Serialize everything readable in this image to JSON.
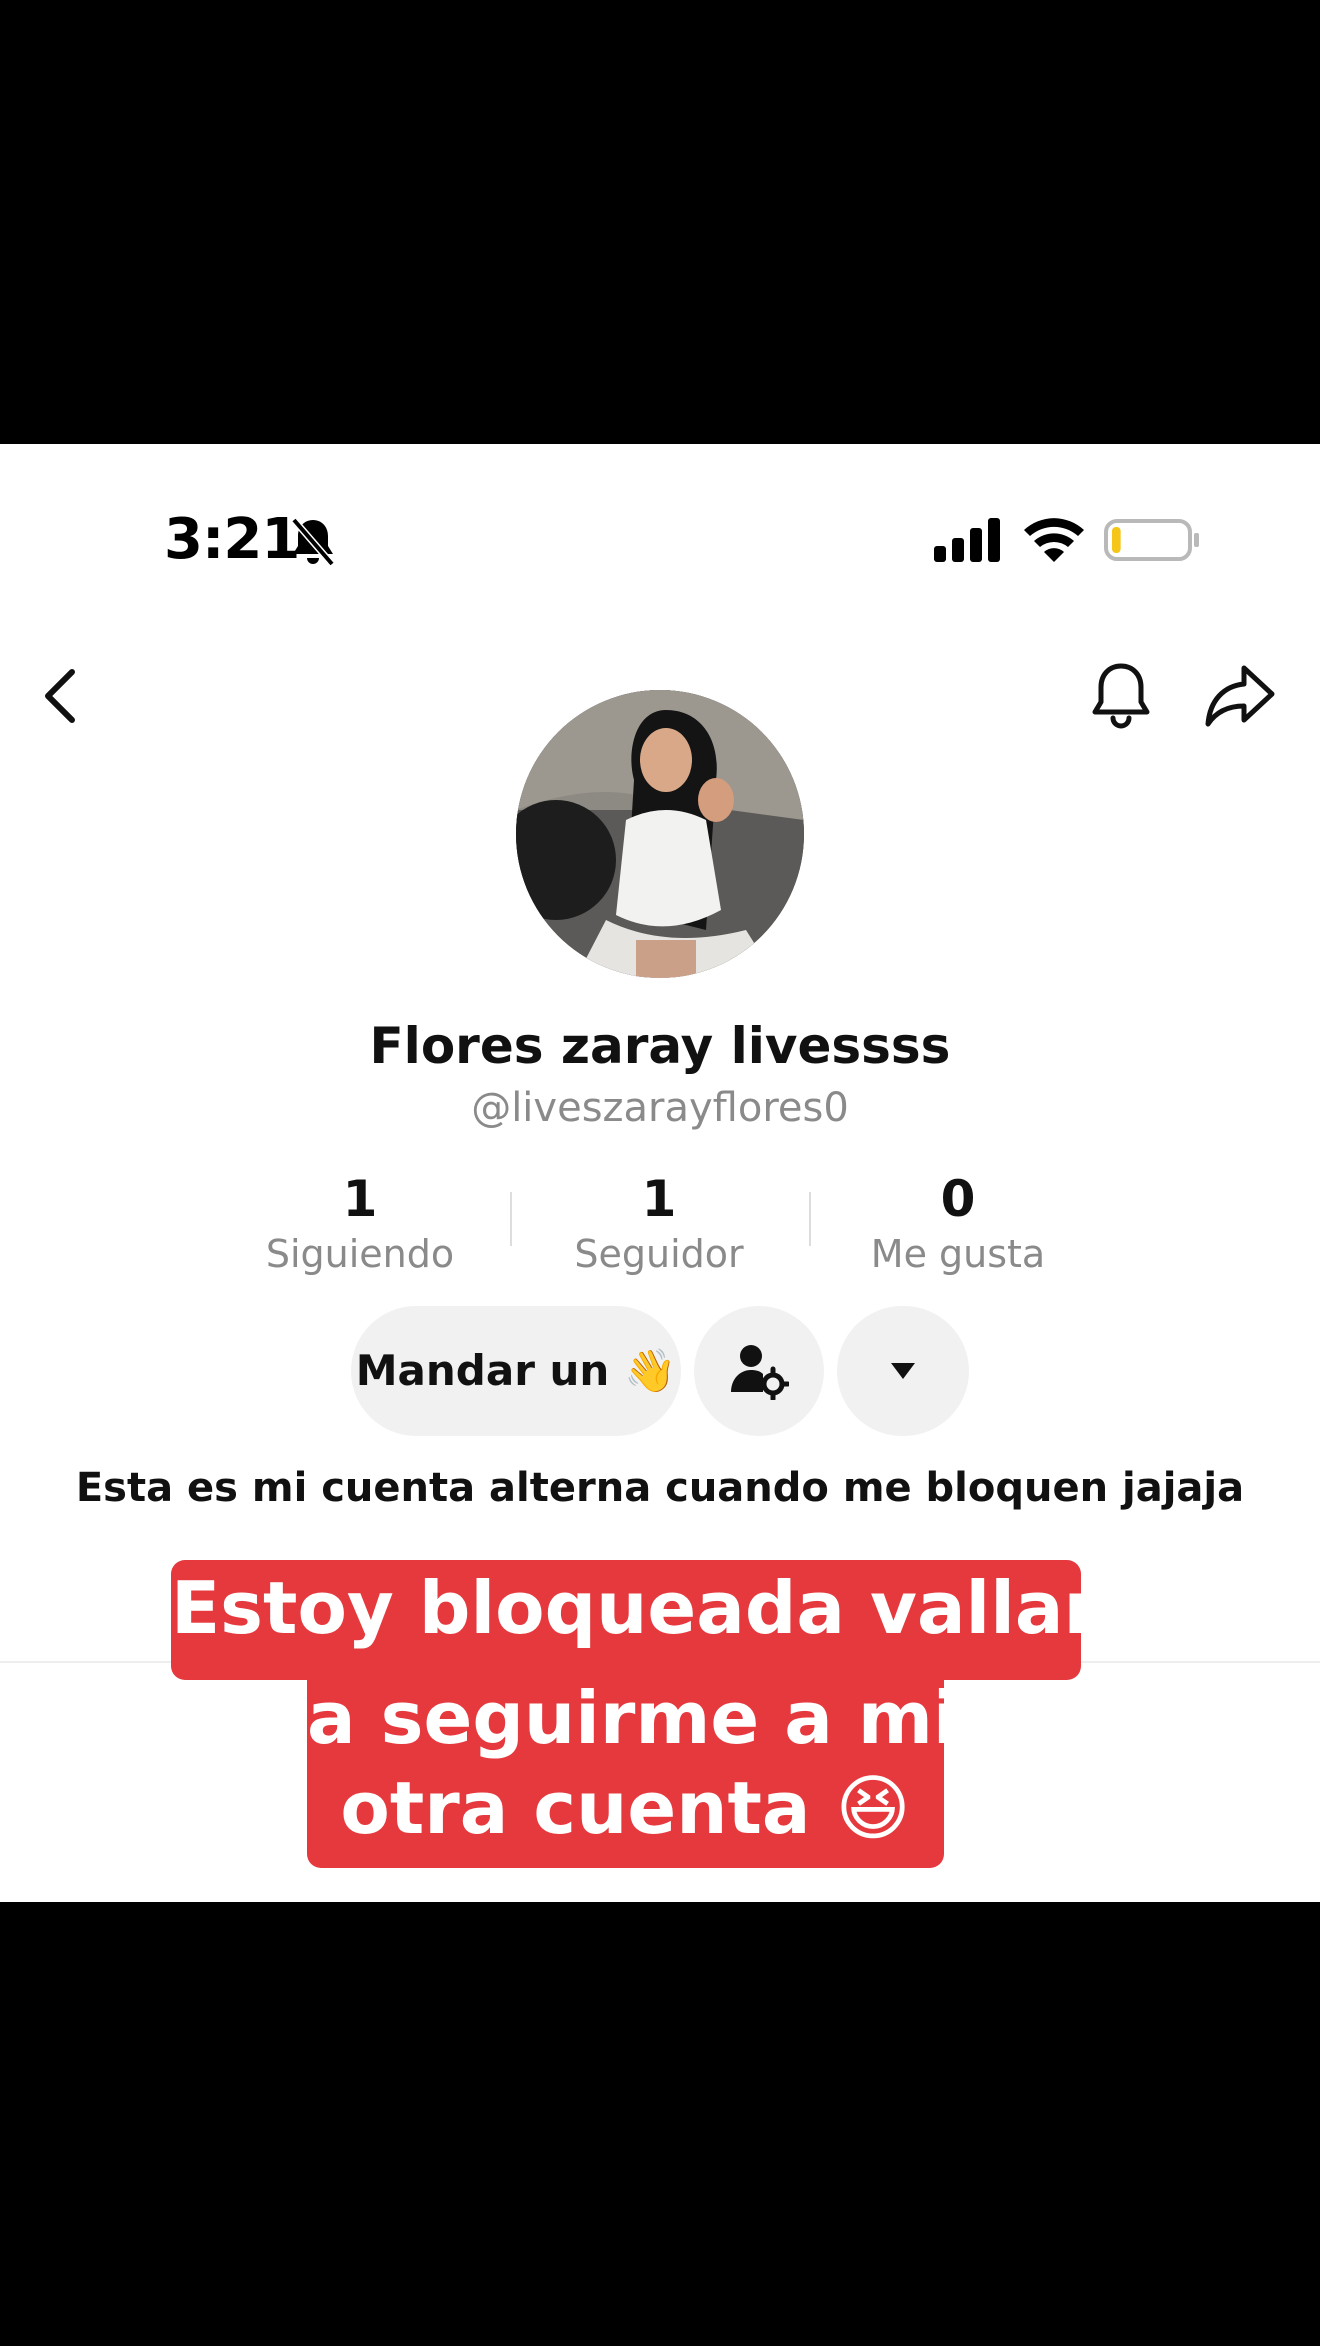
{
  "status_bar": {
    "time": "3:21"
  },
  "profile": {
    "display_name": "Flores zaray livessss",
    "username": "@liveszarayflores0",
    "stats": [
      {
        "value": "1",
        "label": "Siguiendo"
      },
      {
        "value": "1",
        "label": "Seguidor"
      },
      {
        "value": "0",
        "label": "Me gusta"
      }
    ],
    "wave_button": "Mandar un 👋",
    "bio": "Esta es mi cuenta alterna cuando me bloquen jajaja"
  },
  "caption": {
    "lines": [
      "Estoy bloqueada vallan",
      "a seguirme a mi",
      "otra cuenta 😆"
    ]
  },
  "colors": {
    "caption_bg": "#e5393e",
    "button_bg": "#f1f1f1",
    "battery_level": "#f5c518"
  },
  "battery_level": 0.12
}
